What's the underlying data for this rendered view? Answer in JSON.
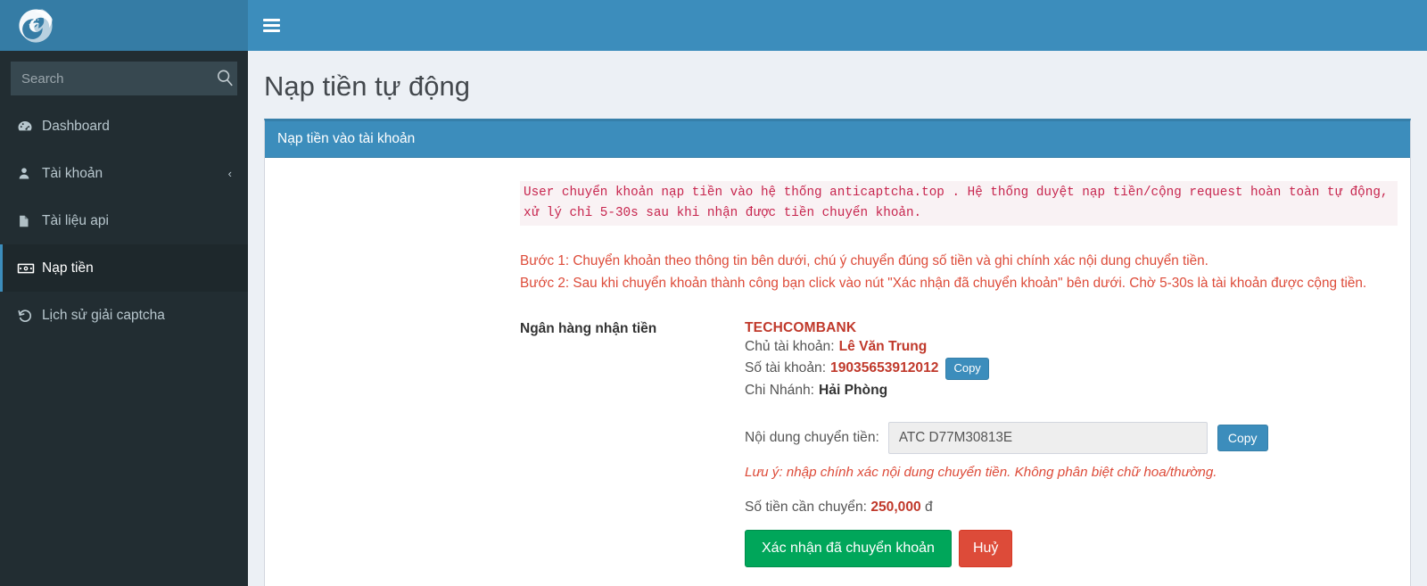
{
  "brand": {
    "logo_icon": "spiral-swirl-logo",
    "header_bg": "#357ca5",
    "navbar_bg": "#3c8dbc"
  },
  "sidebar": {
    "search": {
      "placeholder": "Search",
      "value": "",
      "icon": "search-icon"
    },
    "items": [
      {
        "label": "Dashboard",
        "icon": "dashboard-icon",
        "active": false,
        "chevron": ""
      },
      {
        "label": "Tài khoản",
        "icon": "user-icon",
        "active": false,
        "chevron": "‹"
      },
      {
        "label": "Tài liệu api",
        "icon": "file-icon",
        "active": false,
        "chevron": ""
      },
      {
        "label": "Nạp tiền",
        "icon": "money-bill-icon",
        "active": true,
        "chevron": ""
      },
      {
        "label": "Lịch sử giải captcha",
        "icon": "history-icon",
        "active": false,
        "chevron": ""
      }
    ]
  },
  "navbar": {
    "toggle_icon": "hamburger-icon"
  },
  "page": {
    "title": "Nạp tiền tự động"
  },
  "panel": {
    "heading": "Nạp tiền vào tài khoản",
    "code_note": "User chuyển khoản nạp tiền vào hệ thống anticaptcha.top . Hệ thống duyệt nạp tiền/cộng request hoàn toàn tự động, xử lý chỉ 5-30s sau khi nhận được tiền chuyển khoản.",
    "steps": [
      "Bước 1: Chuyển khoản theo thông tin bên dưới, chú ý chuyển đúng số tiền và ghi chính xác nội dung chuyển tiền.",
      "Bước 2: Sau khi chuyển khoản thành công bạn click vào nút \"Xác nhận đã chuyển khoản\" bên dưới. Chờ 5-30s là tài khoản được cộng tiền."
    ],
    "bank": {
      "section_label": "Ngân hàng nhận tiền",
      "bank_name": "TECHCOMBANK",
      "owner_label": "Chủ tài khoản:",
      "owner_value": "Lê Văn Trung",
      "account_label": "Số tài khoản:",
      "account_value": "19035653912012",
      "account_copy_label": "Copy",
      "branch_label": "Chi Nhánh:",
      "branch_value": "Hải Phòng"
    },
    "transfer": {
      "label": "Nội dung chuyển tiền:",
      "value": "ATC D77M30813E",
      "placeholder": "",
      "copy_label": "Copy",
      "note": "Lưu ý: nhập chính xác nội dung chuyển tiền. Không phân biệt chữ hoa/thường.",
      "amount_label": "Số tiền cần chuyển:",
      "amount_value": "250,000",
      "amount_currency": "đ"
    },
    "actions": {
      "confirm_label": "Xác nhận đã chuyển khoản",
      "cancel_label": "Huỷ"
    }
  }
}
